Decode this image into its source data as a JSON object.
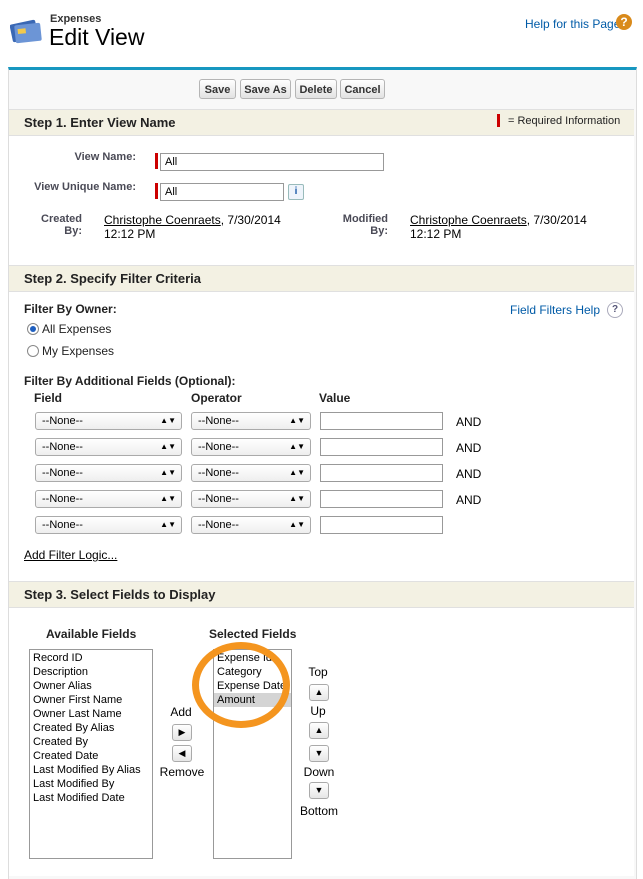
{
  "header": {
    "object_label": "Expenses",
    "title": "Edit View",
    "help_link": "Help for this Page",
    "help_icon": "?"
  },
  "toolbar": {
    "save": "Save",
    "save_as": "Save As",
    "delete": "Delete",
    "cancel": "Cancel"
  },
  "step1": {
    "title": "Step 1. Enter View Name",
    "required_legend": "= Required Information",
    "view_name_label": "View Name:",
    "view_name_value": "All",
    "unique_name_label": "View Unique Name:",
    "unique_name_value": "All",
    "info_icon": "i",
    "created_label_1": "Created",
    "created_label_2": "By:",
    "created_by": "Christophe Coenraets",
    "created_date": ", 7/30/2014",
    "created_time": "12:12 PM",
    "modified_label_1": "Modified",
    "modified_label_2": "By:",
    "modified_by": "Christophe Coenraets",
    "modified_date": ", 7/30/2014",
    "modified_time": "12:12 PM"
  },
  "step2": {
    "title": "Step 2. Specify Filter Criteria",
    "filter_owner_label": "Filter By Owner:",
    "field_filters_help": "Field Filters Help",
    "help_icon": "?",
    "options": [
      "All Expenses",
      "My Expenses"
    ],
    "selected_option": "All Expenses",
    "additional_label": "Filter By Additional Fields (Optional):",
    "col_field": "Field",
    "col_operator": "Operator",
    "col_value": "Value",
    "rows": [
      {
        "field": "--None--",
        "operator": "--None--",
        "value": "",
        "conj": "AND"
      },
      {
        "field": "--None--",
        "operator": "--None--",
        "value": "",
        "conj": "AND"
      },
      {
        "field": "--None--",
        "operator": "--None--",
        "value": "",
        "conj": "AND"
      },
      {
        "field": "--None--",
        "operator": "--None--",
        "value": "",
        "conj": "AND"
      },
      {
        "field": "--None--",
        "operator": "--None--",
        "value": "",
        "conj": ""
      }
    ],
    "add_filter_logic": "Add Filter Logic..."
  },
  "step3": {
    "title": "Step 3. Select Fields to Display",
    "available_label": "Available Fields",
    "selected_label": "Selected Fields",
    "available": [
      "Record ID",
      "Description",
      "Owner Alias",
      "Owner First Name",
      "Owner Last Name",
      "Created By Alias",
      "Created By",
      "Created Date",
      "Last Modified By Alias",
      "Last Modified By",
      "Last Modified Date"
    ],
    "selected": [
      "Expense Id",
      "Category",
      "Expense Date",
      "Amount"
    ],
    "highlighted": "Amount",
    "add_label": "Add",
    "remove_label": "Remove",
    "top_label": "Top",
    "up_label": "Up",
    "down_label": "Down",
    "bottom_label": "Bottom"
  },
  "colors": {
    "accent": "#1797c0",
    "link": "#015ba7",
    "required": "#cc0000",
    "annotation": "#f4951f"
  }
}
